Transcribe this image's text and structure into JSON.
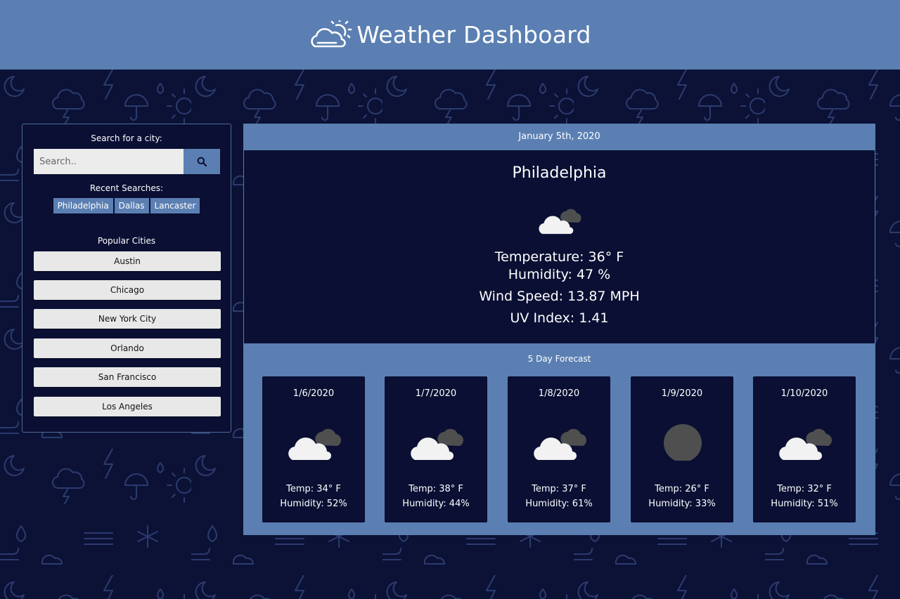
{
  "header": {
    "title": "Weather Dashboard",
    "logo_icon": "cloud-sun-icon"
  },
  "sidebar": {
    "search_label": "Search for a city:",
    "search_placeholder": "Search..",
    "search_value": "",
    "search_icon": "search-icon",
    "recent_label": "Recent Searches:",
    "recent": [
      "Philadelphia",
      "Dallas",
      "Lancaster"
    ],
    "popular_label": "Popular Cities",
    "popular": [
      "Austin",
      "Chicago",
      "New York City",
      "Orlando",
      "San Francisco",
      "Los Angeles"
    ]
  },
  "current": {
    "date": "January 5th, 2020",
    "city": "Philadelphia",
    "icon": "cloudy-icon",
    "temperature": "Temperature: 36° F",
    "humidity": "Humidity: 47 %",
    "wind": "Wind Speed: 13.87 MPH",
    "uv": "UV Index: 1.41"
  },
  "forecast": {
    "title": "5 Day Forecast",
    "days": [
      {
        "date": "1/6/2020",
        "icon": "cloudy-icon",
        "temp": "Temp: 34° F",
        "humidity": "Humidity: 52%"
      },
      {
        "date": "1/7/2020",
        "icon": "cloudy-icon",
        "temp": "Temp: 38° F",
        "humidity": "Humidity: 44%"
      },
      {
        "date": "1/8/2020",
        "icon": "cloudy-icon",
        "temp": "Temp: 37° F",
        "humidity": "Humidity: 61%"
      },
      {
        "date": "1/9/2020",
        "icon": "overcast-icon",
        "temp": "Temp: 26° F",
        "humidity": "Humidity: 33%"
      },
      {
        "date": "1/10/2020",
        "icon": "cloudy-icon",
        "temp": "Temp: 32° F",
        "humidity": "Humidity: 51%"
      }
    ]
  },
  "colors": {
    "header_bg": "#5b7fb2",
    "page_bg": "#0b1236",
    "card_bg": "#0a0f33",
    "button_bg": "#e8e8e8"
  }
}
